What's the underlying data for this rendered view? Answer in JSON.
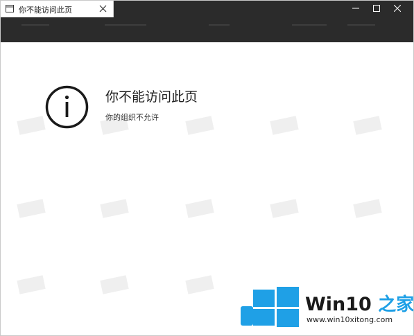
{
  "tab": {
    "title": "你不能访问此页"
  },
  "error": {
    "title": "你不能访问此页",
    "message": "你的组织不允许"
  },
  "watermark": {
    "brand_name": "Win10",
    "brand_zh": "之家",
    "url": "www.win10xitong.com"
  },
  "colors": {
    "titlebar": "#2b2b2b",
    "brand_blue": "#1fa0e6"
  },
  "icons": [
    "tab-page-icon",
    "close-icon",
    "minimize-icon",
    "maximize-icon",
    "window-close-icon",
    "info-icon",
    "windows-logo-icon"
  ]
}
